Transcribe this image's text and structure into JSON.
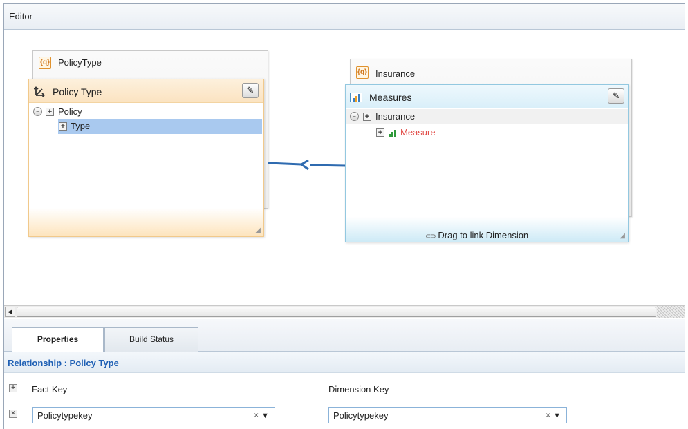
{
  "editor": {
    "title": "Editor"
  },
  "canvas": {
    "left_table": {
      "title": "PolicyType"
    },
    "right_table": {
      "title": "Insurance"
    },
    "dimension_panel": {
      "title": "Policy Type",
      "tree": [
        {
          "label": "Policy",
          "level": 0,
          "selected": false
        },
        {
          "label": "Type",
          "level": 1,
          "selected": true
        }
      ]
    },
    "measures_panel": {
      "title": "Measures",
      "tree": [
        {
          "label": "Insurance",
          "level": 0
        },
        {
          "label": "Measure",
          "level": 1
        }
      ],
      "footer": "Drag to link Dimension"
    }
  },
  "properties": {
    "tabs": [
      {
        "label": "Properties",
        "active": true
      },
      {
        "label": "Build Status",
        "active": false
      }
    ],
    "relationship": "Relationship :  Policy Type",
    "fact_key_label": "Fact Key",
    "dimension_key_label": "Dimension Key",
    "fact_key_value": "Policytypekey",
    "dimension_key_value": "Policytypekey",
    "clear_glyph": "×",
    "dropdown_glyph": "▼"
  },
  "colors": {
    "link_line": "#2f6bb0",
    "selected_row": "#a9c9ef",
    "measure_text": "#e2504b",
    "relationship_text": "#1e5fb4"
  }
}
